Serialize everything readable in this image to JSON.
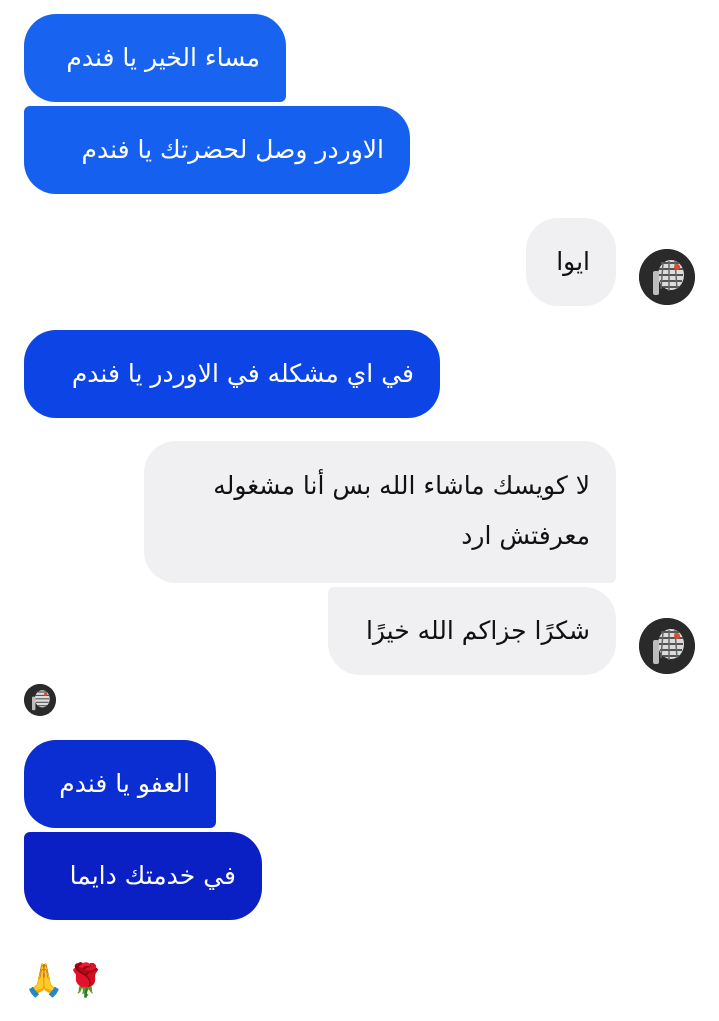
{
  "conversation": {
    "messages": [
      {
        "text": "مساء الخير يا فندم",
        "direction": "sent"
      },
      {
        "text": "الاوردر وصل لحضرتك يا فندم",
        "direction": "sent"
      },
      {
        "text": "ايوا",
        "direction": "received"
      },
      {
        "text": "في اي مشكله في الاوردر يا فندم",
        "direction": "sent"
      },
      {
        "text": "لا كويسك ماشاء الله بس أنا مشغوله معرفتش ارد",
        "direction": "received"
      },
      {
        "text": "شكرًا جزاكم الله خيرًا",
        "direction": "received"
      },
      {
        "text": "العفو يا فندم",
        "direction": "sent"
      },
      {
        "text": "في خدمتك دايما",
        "direction": "sent"
      }
    ],
    "reactions": "🙏🌹"
  },
  "colors": {
    "sent_bubble_top": "#1a66f0",
    "sent_bubble_mid": "#0b3ce0",
    "sent_bubble_bottom": "#0a1fc4",
    "received_bubble": "#f0f0f3",
    "avatar_background": "#2a2a2a"
  },
  "icons": {
    "avatar": "contact-avatar-icon"
  }
}
